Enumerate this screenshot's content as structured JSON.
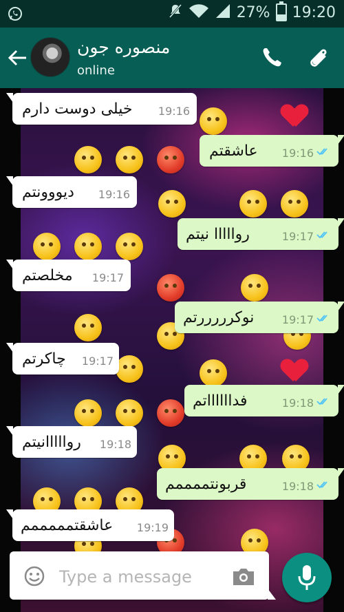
{
  "status_bar": {
    "battery_percent": "27%",
    "time": "19:20",
    "icons": [
      "whatsapp-icon",
      "mute-icon",
      "wifi-icon",
      "signal-icon",
      "battery-icon"
    ]
  },
  "header": {
    "contact_name": "منصوره جون",
    "status": "online",
    "icons": [
      "back-arrow-icon",
      "avatar",
      "phone-icon",
      "paperclip-icon"
    ]
  },
  "messages": [
    {
      "dir": "in",
      "text": "خیلی دوست دارم",
      "time": "19:16"
    },
    {
      "dir": "out",
      "text": "عاشقتم",
      "time": "19:16"
    },
    {
      "dir": "in",
      "text": "دیووونتم",
      "time": "19:16"
    },
    {
      "dir": "out",
      "text": "روااااا نیتم",
      "time": "19:17"
    },
    {
      "dir": "in",
      "text": "مخلصتم",
      "time": "19:17"
    },
    {
      "dir": "out",
      "text": "نوکرررررتم",
      "time": "19:17"
    },
    {
      "dir": "in",
      "text": "چاکرتم",
      "time": "19:17"
    },
    {
      "dir": "out",
      "text": "فدااااااتم",
      "time": "19:18"
    },
    {
      "dir": "in",
      "text": "روااااانیتم",
      "time": "19:18"
    },
    {
      "dir": "out",
      "text": "قربونتممممم",
      "time": "19:18"
    },
    {
      "dir": "in",
      "text": "عاشقتمممممم",
      "time": "19:19"
    }
  ],
  "composer": {
    "placeholder": "Type a message",
    "value": ""
  },
  "colors": {
    "statusbar": "#062f29",
    "appbar": "#075e54",
    "incoming_bubble": "#ffffff",
    "outgoing_bubble": "#dcf8c6",
    "read_ticks": "#4fc3f7",
    "mic_button": "#0a8f80"
  }
}
